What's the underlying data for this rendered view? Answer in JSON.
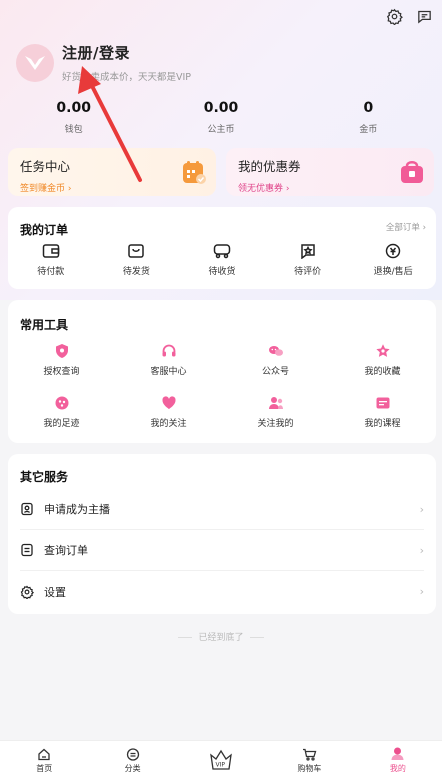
{
  "profile": {
    "title": "注册/登录",
    "subtitle": "好货只卖成本价，天天都是VIP"
  },
  "stats": [
    {
      "value": "0.00",
      "label": "钱包"
    },
    {
      "value": "0.00",
      "label": "公主币"
    },
    {
      "value": "0",
      "label": "金币"
    }
  ],
  "promos": {
    "task": {
      "title": "任务中心",
      "sub": "签到赚金币 ›"
    },
    "coupon": {
      "title": "我的优惠券",
      "sub": "领无优惠券 ›"
    }
  },
  "orders": {
    "title": "我的订单",
    "all": "全部订单 ›",
    "items": [
      {
        "label": "待付款",
        "icon": "wallet-icon"
      },
      {
        "label": "待发货",
        "icon": "box-icon"
      },
      {
        "label": "待收货",
        "icon": "truck-icon"
      },
      {
        "label": "待评价",
        "icon": "review-icon"
      },
      {
        "label": "退换/售后",
        "icon": "refund-icon"
      }
    ]
  },
  "tools": {
    "title": "常用工具",
    "row1": [
      {
        "label": "授权查询",
        "icon": "shield-icon"
      },
      {
        "label": "客服中心",
        "icon": "headset-icon"
      },
      {
        "label": "公众号",
        "icon": "chat-icon"
      },
      {
        "label": "我的收藏",
        "icon": "star-icon"
      }
    ],
    "row2": [
      {
        "label": "我的足迹",
        "icon": "footprint-icon"
      },
      {
        "label": "我的关注",
        "icon": "heart-icon"
      },
      {
        "label": "关注我的",
        "icon": "followers-icon"
      },
      {
        "label": "我的课程",
        "icon": "course-icon"
      }
    ]
  },
  "services": {
    "title": "其它服务",
    "items": [
      {
        "label": "申请成为主播",
        "icon": "anchor-icon"
      },
      {
        "label": "查询订单",
        "icon": "order-list-icon"
      },
      {
        "label": "设置",
        "icon": "settings-icon"
      }
    ]
  },
  "end_text": "已经到底了",
  "tabs": [
    {
      "label": "首页",
      "icon": "home-icon"
    },
    {
      "label": "分类",
      "icon": "category-icon"
    },
    {
      "label": "",
      "icon": "vip-crown-icon"
    },
    {
      "label": "购物车",
      "icon": "cart-icon"
    },
    {
      "label": "我的",
      "icon": "profile-icon"
    }
  ],
  "colors": {
    "accent": "#ec4f8d",
    "task_sub": "#f08a2a",
    "coupon_sub": "#e0458a"
  }
}
